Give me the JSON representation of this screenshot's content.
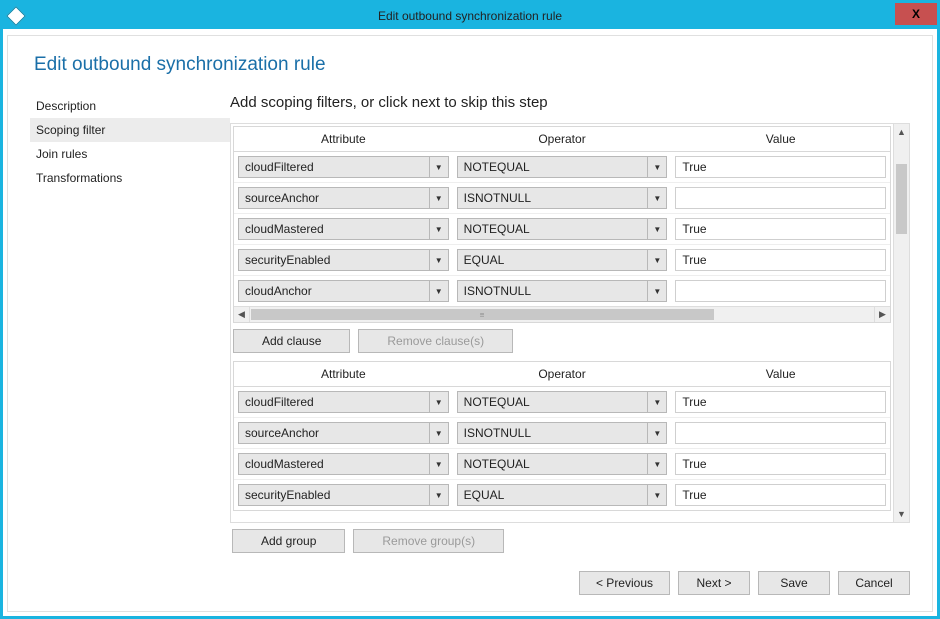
{
  "window": {
    "title": "Edit outbound synchronization rule",
    "close_label": "X"
  },
  "page": {
    "heading": "Edit outbound synchronization rule",
    "instruction": "Add scoping filters, or click next to skip this step"
  },
  "sidebar": {
    "items": [
      {
        "label": "Description",
        "active": false
      },
      {
        "label": "Scoping filter",
        "active": true
      },
      {
        "label": "Join rules",
        "active": false
      },
      {
        "label": "Transformations",
        "active": false
      }
    ]
  },
  "columns": {
    "attribute": "Attribute",
    "operator": "Operator",
    "value": "Value"
  },
  "groups": [
    {
      "rows": [
        {
          "attribute": "cloudFiltered",
          "operator": "NOTEQUAL",
          "value": "True"
        },
        {
          "attribute": "sourceAnchor",
          "operator": "ISNOTNULL",
          "value": ""
        },
        {
          "attribute": "cloudMastered",
          "operator": "NOTEQUAL",
          "value": "True"
        },
        {
          "attribute": "securityEnabled",
          "operator": "EQUAL",
          "value": "True"
        },
        {
          "attribute": "cloudAnchor",
          "operator": "ISNOTNULL",
          "value": ""
        }
      ],
      "show_hscroll": true,
      "buttons": {
        "add": "Add clause",
        "remove": "Remove clause(s)"
      }
    },
    {
      "rows": [
        {
          "attribute": "cloudFiltered",
          "operator": "NOTEQUAL",
          "value": "True"
        },
        {
          "attribute": "sourceAnchor",
          "operator": "ISNOTNULL",
          "value": ""
        },
        {
          "attribute": "cloudMastered",
          "operator": "NOTEQUAL",
          "value": "True"
        },
        {
          "attribute": "securityEnabled",
          "operator": "EQUAL",
          "value": "True"
        }
      ],
      "show_hscroll": false,
      "buttons": null
    }
  ],
  "group_buttons": {
    "add": "Add group",
    "remove": "Remove group(s)"
  },
  "footer": {
    "previous": "< Previous",
    "next": "Next >",
    "save": "Save",
    "cancel": "Cancel"
  }
}
